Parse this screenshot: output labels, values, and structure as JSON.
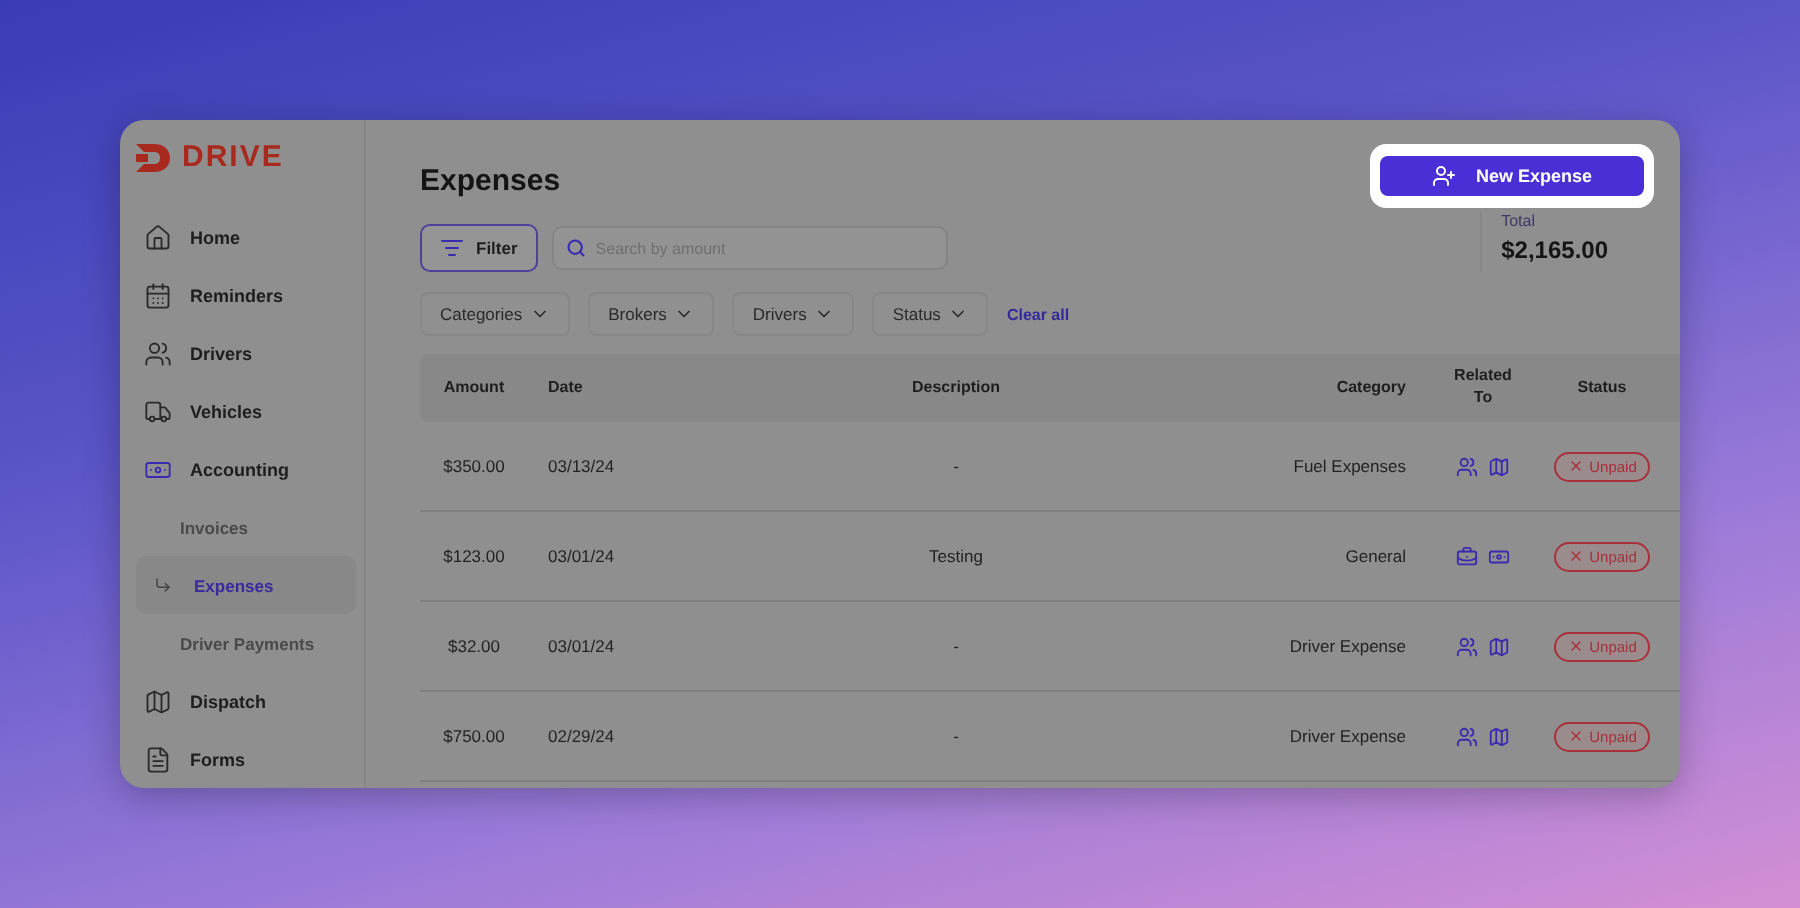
{
  "logo": "DRIVE",
  "sidebar": {
    "items": [
      {
        "label": "Home",
        "selected": false
      },
      {
        "label": "Reminders",
        "selected": false
      },
      {
        "label": "Drivers",
        "selected": false
      },
      {
        "label": "Vehicles",
        "selected": false
      },
      {
        "label": "Accounting",
        "selected": false,
        "expanded": true,
        "children": [
          {
            "label": "Invoices",
            "selected": false
          },
          {
            "label": "Expenses",
            "selected": true
          },
          {
            "label": "Driver Payments",
            "selected": false
          }
        ]
      },
      {
        "label": "Dispatch",
        "selected": false
      },
      {
        "label": "Forms",
        "selected": false
      }
    ]
  },
  "page_title": "Expenses",
  "new_button": "New Expense",
  "filter_button": "Filter",
  "search": {
    "placeholder": "Search by amount"
  },
  "total": {
    "label": "Total",
    "value": "$2,165.00"
  },
  "filters": [
    "Categories",
    "Brokers",
    "Drivers",
    "Status"
  ],
  "clear_all": "Clear all",
  "table": {
    "columns": [
      "Amount",
      "Date",
      "Description",
      "Category",
      "Related To",
      "Status"
    ],
    "rows": [
      {
        "amount": "$350.00",
        "date": "03/13/24",
        "description": "-",
        "category": "Fuel Expenses",
        "related": [
          {
            "kind": "driver"
          },
          {
            "kind": "route"
          }
        ],
        "status": {
          "label": "Unpaid",
          "kind": "unpaid"
        }
      },
      {
        "amount": "$123.00",
        "date": "03/01/24",
        "description": "Testing",
        "category": "General",
        "related": [
          {
            "kind": "broker"
          },
          {
            "kind": "payment"
          }
        ],
        "status": {
          "label": "Unpaid",
          "kind": "unpaid"
        }
      },
      {
        "amount": "$32.00",
        "date": "03/01/24",
        "description": "-",
        "category": "Driver Expense",
        "related": [
          {
            "kind": "driver"
          },
          {
            "kind": "route"
          }
        ],
        "status": {
          "label": "Unpaid",
          "kind": "unpaid"
        }
      },
      {
        "amount": "$750.00",
        "date": "02/29/24",
        "description": "-",
        "category": "Driver Expense",
        "related": [
          {
            "kind": "driver"
          },
          {
            "kind": "route"
          }
        ],
        "status": {
          "label": "Unpaid",
          "kind": "unpaid"
        }
      }
    ]
  }
}
